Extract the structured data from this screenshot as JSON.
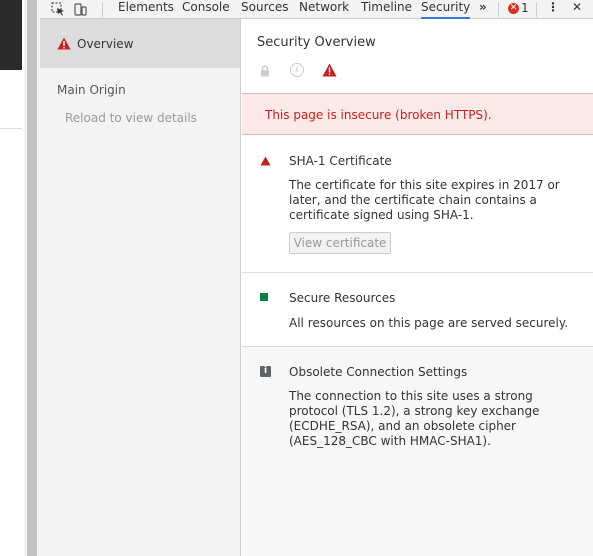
{
  "toolbar": {
    "tabs": [
      "Elements",
      "Console",
      "Sources",
      "Network",
      "Timeline",
      "Security"
    ],
    "more_label": "»",
    "error_count": "1",
    "error_glyph": "✕",
    "menu_glyph": "⋮",
    "close_glyph": "✕",
    "active_tab": "Security"
  },
  "sidebar": {
    "overview_label": "Overview",
    "main_origin_label": "Main Origin",
    "reload_hint": "Reload to view details"
  },
  "main": {
    "title": "Security Overview",
    "info_glyph": "i",
    "banner_text": "This page is insecure (broken HTTPS).",
    "sections": [
      {
        "title": "SHA-1 Certificate",
        "description": "The certificate for this site expires in 2017 or later, and the certificate chain contains a certificate signed using SHA-1.",
        "button_label": "View certificate",
        "icon": "warning-icon"
      },
      {
        "title": "Secure Resources",
        "description": "All resources on this page are served securely.",
        "icon": "secure-square-icon"
      },
      {
        "title": "Obsolete Connection Settings",
        "description": "The connection to this site uses a strong protocol (TLS 1.2), a strong key exchange (ECDHE_RSA), and an obsolete cipher (AES_128_CBC with HMAC-SHA1).",
        "icon": "info-icon",
        "icon_glyph": "i"
      }
    ]
  },
  "colors": {
    "warning_red": "#c5221f",
    "secure_green": "#0b8043",
    "active_tab_blue": "#3879d9",
    "banner_bg": "#fbe9e7"
  }
}
